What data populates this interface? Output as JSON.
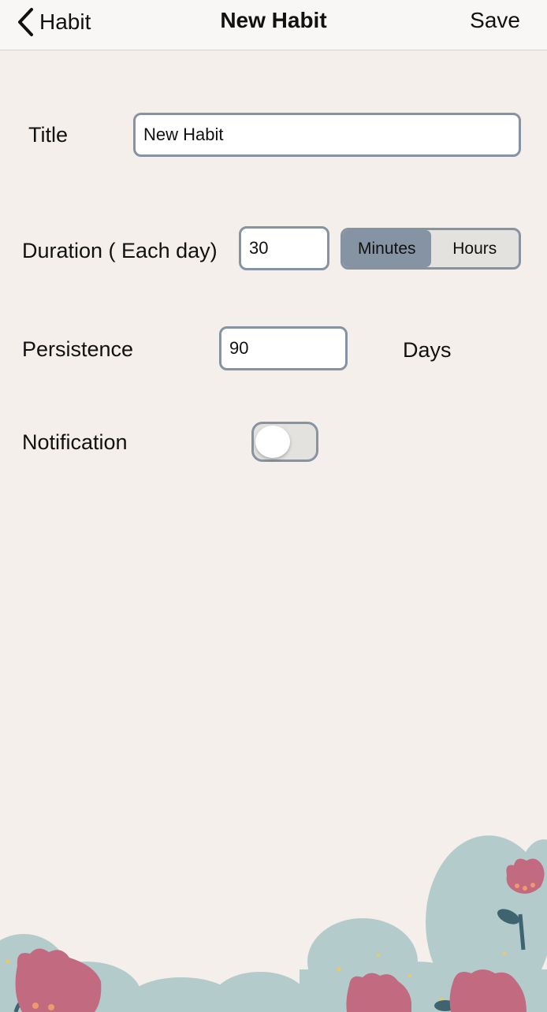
{
  "navbar": {
    "back_label": "Habit",
    "title": "New Habit",
    "save_label": "Save"
  },
  "form": {
    "title_label": "Title",
    "title_value": "New Habit",
    "duration_label": "Duration ( Each day)",
    "duration_value": "30",
    "unit_options": [
      "Minutes",
      "Hours"
    ],
    "unit_selected": "Minutes",
    "persistence_label": "Persistence",
    "persistence_value": "90",
    "persistence_unit": "Days",
    "notification_label": "Notification",
    "notification_on": false
  },
  "colors": {
    "background": "#f4efea",
    "accent": "#8593a2",
    "flower_pink": "#c26a80",
    "foliage": "#b3cccb"
  },
  "icons": {
    "back": "chevron-left-icon",
    "decoration": "flowers-illustration"
  }
}
